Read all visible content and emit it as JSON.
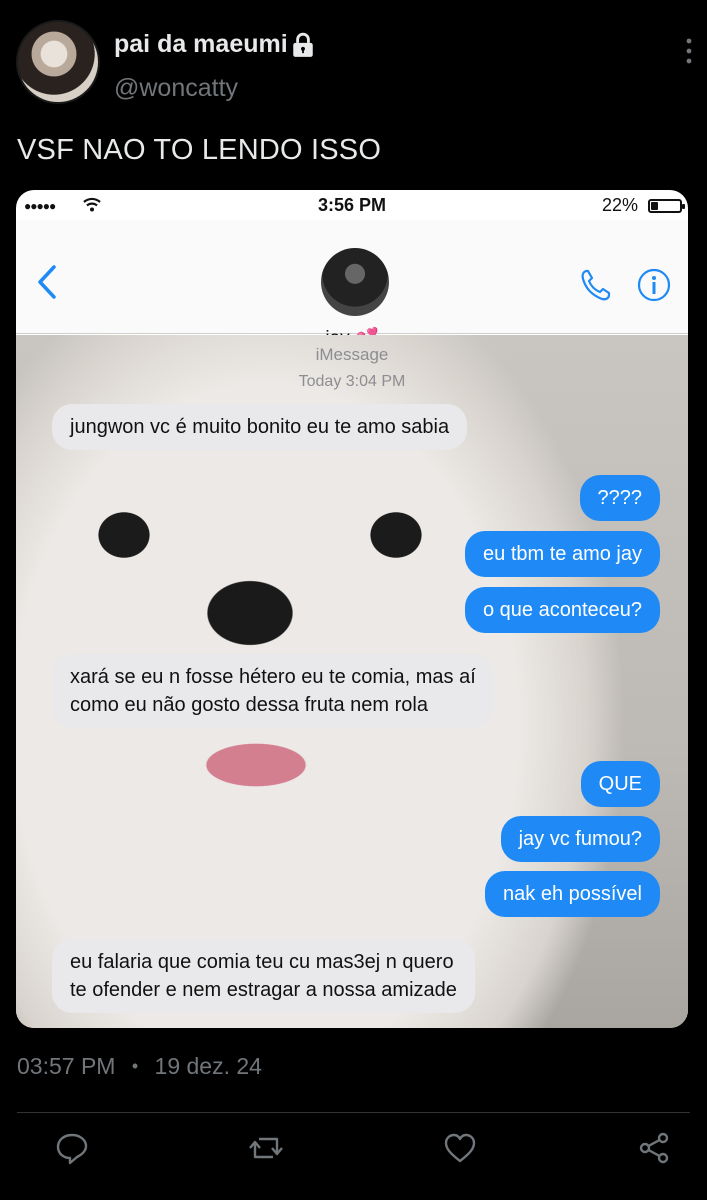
{
  "author": {
    "display_name": "pai da maeumi",
    "handle": "@woncatty",
    "lock_icon": "lock-icon"
  },
  "tweet": {
    "text": "VSF NAO TO LENDO ISSO",
    "time": "03:57 PM",
    "separator": "•",
    "date": "19 dez. 24"
  },
  "screenshot": {
    "status": {
      "signal": "●●●●●",
      "time": "3:56 PM",
      "battery_text": "22%",
      "battery_level": 0.22
    },
    "contact_name": "jay 💕",
    "service_label": "iMessage",
    "timestamp_label": "Today 3:04 PM",
    "messages": [
      {
        "side": "received",
        "text": "jungwon vc é muito bonito eu te amo sabia"
      },
      {
        "side": "sent",
        "text": "????"
      },
      {
        "side": "sent",
        "text": "eu tbm te amo jay"
      },
      {
        "side": "sent",
        "text": "o que aconteceu?"
      },
      {
        "side": "received",
        "lines": [
          "xará se eu n fosse hétero eu te comia, mas aí",
          "como eu não gosto dessa fruta nem rola"
        ]
      },
      {
        "side": "sent",
        "text": "QUE"
      },
      {
        "side": "sent",
        "text": "jay vc fumou?"
      },
      {
        "side": "sent",
        "text": "nak eh possível"
      },
      {
        "side": "received",
        "lines": [
          "eu falaria que comia teu cu mas3ej n quero",
          "te ofender e nem estragar a nossa amizade"
        ]
      }
    ]
  },
  "actions": [
    "reply-icon",
    "retweet-icon",
    "like-icon",
    "share-icon"
  ],
  "colors": {
    "background": "#000000",
    "text_primary": "#e7e9ea",
    "text_secondary": "#71767b",
    "imessage_blue": "#1f8af5",
    "imessage_gray": "#e9e9eb"
  }
}
